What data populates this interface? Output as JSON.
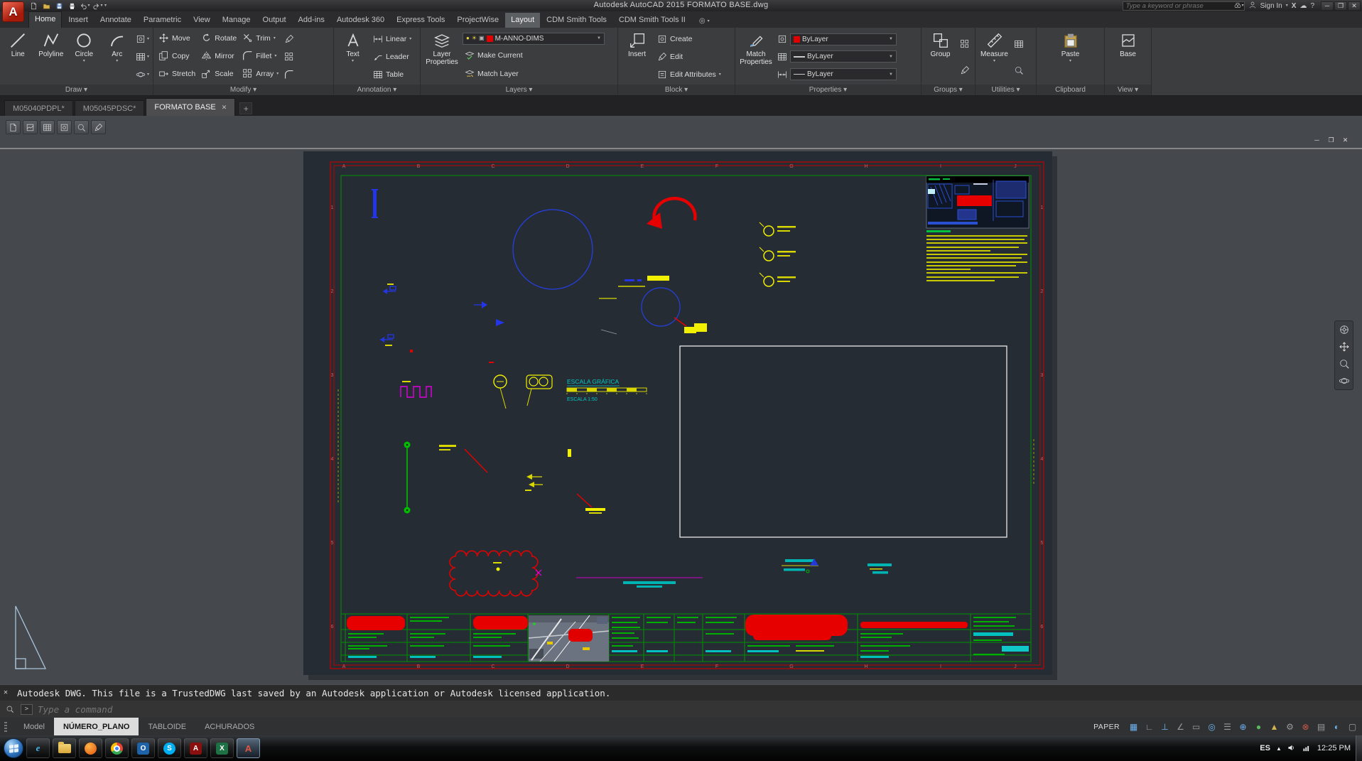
{
  "colors": {
    "accent_red": "#e60000",
    "cad_yellow": "#f0f000",
    "cad_cyan": "#00c8c8",
    "cad_green": "#00b000",
    "cad_blue": "#2440e0",
    "cad_magenta": "#e000e0",
    "paper_bg": "#262c34",
    "layer_color": "#e00000"
  },
  "titlebar": {
    "app_title": "Autodesk AutoCAD 2015   FORMATO BASE.dwg",
    "search_placeholder": "Type a keyword or phrase",
    "sign_in_label": "Sign In"
  },
  "ribbon": {
    "tabs": [
      {
        "label": "Home",
        "active": true
      },
      {
        "label": "Insert"
      },
      {
        "label": "Annotate"
      },
      {
        "label": "Parametric"
      },
      {
        "label": "View"
      },
      {
        "label": "Manage"
      },
      {
        "label": "Output"
      },
      {
        "label": "Add-ins"
      },
      {
        "label": "Autodesk 360"
      },
      {
        "label": "Express Tools"
      },
      {
        "label": "ProjectWise"
      },
      {
        "label": "Layout",
        "highlighted": true
      },
      {
        "label": "CDM Smith Tools"
      },
      {
        "label": "CDM Smith Tools II"
      }
    ],
    "draw": {
      "label": "Draw",
      "line": "Line",
      "polyline": "Polyline",
      "circle": "Circle",
      "arc": "Arc"
    },
    "modify": {
      "label": "Modify",
      "move": "Move",
      "rotate": "Rotate",
      "trim": "Trim",
      "copy": "Copy",
      "mirror": "Mirror",
      "fillet": "Fillet",
      "stretch": "Stretch",
      "scale": "Scale",
      "array": "Array"
    },
    "annotation": {
      "label": "Annotation",
      "text": "Text",
      "linear": "Linear",
      "leader": "Leader",
      "table": "Table"
    },
    "layers": {
      "label": "Layers",
      "layer_properties": "Layer Properties",
      "layer_combo_value": "M-ANNO-DIMS",
      "make_current": "Make Current",
      "match_layer": "Match Layer"
    },
    "block": {
      "label": "Block",
      "insert": "Insert",
      "create": "Create",
      "edit": "Edit",
      "edit_attributes": "Edit Attributes"
    },
    "properties": {
      "label": "Properties",
      "match_properties": "Match Properties",
      "color_value": "ByLayer",
      "lineweight_value": "ByLayer",
      "linetype_value": "ByLayer"
    },
    "groups": {
      "label": "Groups",
      "group": "Group"
    },
    "utilities": {
      "label": "Utilities",
      "measure": "Measure"
    },
    "clipboard": {
      "label": "Clipboard",
      "paste": "Paste"
    },
    "view": {
      "label": "View",
      "base": "Base"
    }
  },
  "doc_tabs": [
    {
      "label": "M05040PDPL*"
    },
    {
      "label": "M05045PDSC*"
    },
    {
      "label": "FORMATO BASE",
      "active": true
    }
  ],
  "drawing": {
    "frame_letters": [
      "A",
      "B",
      "C",
      "D",
      "E",
      "F",
      "G",
      "H",
      "I",
      "J"
    ],
    "frame_numbers": [
      "1",
      "2",
      "3",
      "4",
      "5",
      "6"
    ],
    "escala_grafica_title": "ESCALA GRÁFICA",
    "escala_grafica_caption": "ESCALA 1:50"
  },
  "command": {
    "message": "Autodesk DWG.  This file is a TrustedDWG last saved by an Autodesk application or Autodesk licensed application.",
    "prompt_placeholder": "Type a command"
  },
  "layout_tabs": [
    {
      "label": "Model"
    },
    {
      "label": "NÚMERO_PLANO",
      "active": true
    },
    {
      "label": "TABLOIDE"
    },
    {
      "label": "ACHURADOS"
    }
  ],
  "statusbar": {
    "paper_label": "PAPER"
  },
  "taskbar": {
    "language": "ES",
    "time": "12:25 PM"
  }
}
